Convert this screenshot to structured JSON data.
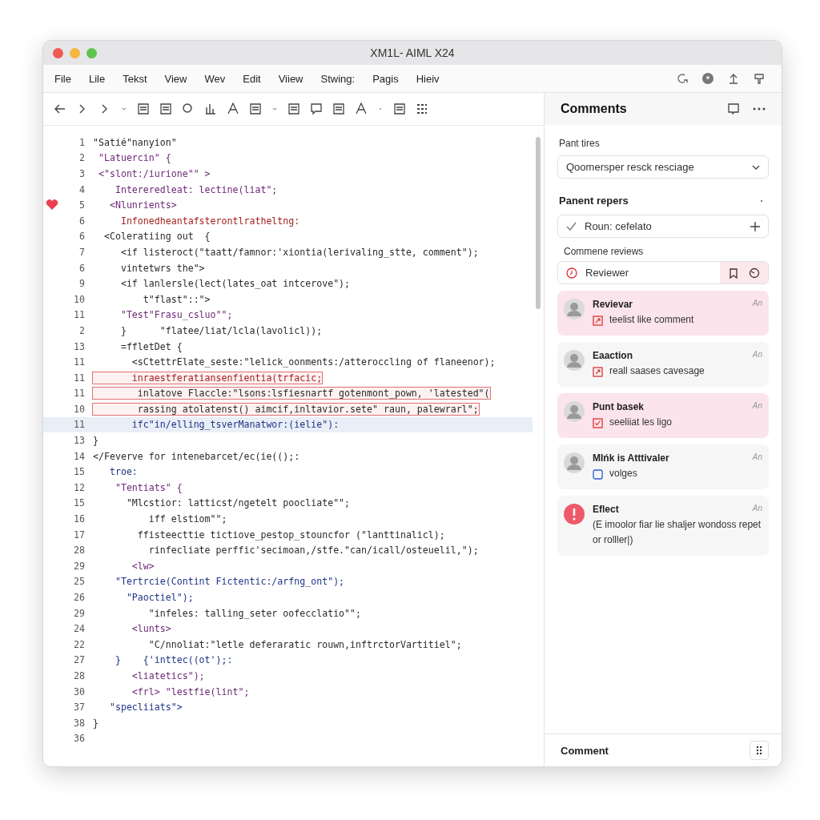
{
  "window": {
    "title": "XM1L- AIML X24"
  },
  "menu": [
    "File",
    "Lile",
    "Tekst",
    "View",
    "Wev",
    "Edit",
    "Viiew",
    "Stwing:",
    "Pagis",
    "Hieiv"
  ],
  "code": [
    {
      "n": "1",
      "text": "\"Satié\"nanyion\"",
      "kind": "plain",
      "flagged": false,
      "selected": false,
      "bookmarked": false
    },
    {
      "n": "2",
      "text": " \"Latuercin\" {",
      "kind": "tag",
      "flagged": false,
      "selected": false,
      "bookmarked": false
    },
    {
      "n": "3",
      "text": " <\"slont:/iurione\"\" >",
      "kind": "tag",
      "flagged": false,
      "selected": false,
      "bookmarked": false
    },
    {
      "n": "4",
      "text": "    Intereredleat: lectine(liat\";",
      "kind": "tag",
      "flagged": false,
      "selected": false,
      "bookmarked": false
    },
    {
      "n": "5",
      "text": "   <Nlunrients>",
      "kind": "tag",
      "flagged": false,
      "selected": false,
      "bookmarked": true
    },
    {
      "n": "6",
      "text": "     Infonedheantafsterontlratheltng:",
      "kind": "error",
      "flagged": false,
      "selected": false,
      "bookmarked": false
    },
    {
      "n": "6",
      "text": "  <Coleratiing out  {",
      "kind": "plain",
      "flagged": false,
      "selected": false,
      "bookmarked": false
    },
    {
      "n": "7",
      "text": "     <if listeroct(\"taatt/famnor:'xiontia(lerivaling_stte, comment\");",
      "kind": "plain",
      "flagged": false,
      "selected": false,
      "bookmarked": false
    },
    {
      "n": "6",
      "text": "     vintetwrs the\">",
      "kind": "plain",
      "flagged": false,
      "selected": false,
      "bookmarked": false
    },
    {
      "n": "9",
      "text": "     <if lanlersle(lect(lates_oat intcerove\");",
      "kind": "plain",
      "flagged": false,
      "selected": false,
      "bookmarked": false
    },
    {
      "n": "10",
      "text": "         t\"flast\"::\">",
      "kind": "plain",
      "flagged": false,
      "selected": false,
      "bookmarked": false
    },
    {
      "n": "11",
      "text": "     \"Test\"Frasu_csluo\"\";",
      "kind": "tag",
      "flagged": false,
      "selected": false,
      "bookmarked": false
    },
    {
      "n": "2",
      "text": "     }      \"flatee/liat/lcla(lavolicl));",
      "kind": "plain",
      "flagged": false,
      "selected": false,
      "bookmarked": false
    },
    {
      "n": "13",
      "text": "     =ffletDet {",
      "kind": "plain",
      "flagged": false,
      "selected": false,
      "bookmarked": false
    },
    {
      "n": "11",
      "text": "       <sCtettrElate_seste:\"lelick_oonments:/atteroccling of flaneenor);",
      "kind": "plain",
      "flagged": false,
      "selected": false,
      "bookmarked": false
    },
    {
      "n": "11",
      "text": "       inraestferatiansenfientia(trfacic;",
      "kind": "error",
      "flagged": true,
      "selected": false,
      "bookmarked": false
    },
    {
      "n": "11",
      "text": "        inlatove Flaccle:\"lsons:lsfiesnartf gotenmont_pown, 'latested\"(",
      "kind": "plain",
      "flagged": true,
      "selected": false,
      "bookmarked": false
    },
    {
      "n": "10",
      "text": "        rassing atolatenst() aimcif,inltavior.sete\" raun, palewrarl\";",
      "kind": "plain",
      "flagged": true,
      "selected": false,
      "bookmarked": false
    },
    {
      "n": "11",
      "text": "       ifc\"in/elling_tsverManatwor:(ielie\"):",
      "kind": "string",
      "flagged": false,
      "selected": true,
      "bookmarked": false
    },
    {
      "n": "13",
      "text": "}",
      "kind": "plain",
      "flagged": false,
      "selected": false,
      "bookmarked": false
    },
    {
      "n": "14",
      "text": "</Feverve for intenebarcet/ec(ie(();:",
      "kind": "plain",
      "flagged": false,
      "selected": false,
      "bookmarked": false
    },
    {
      "n": "15",
      "text": "   troe:",
      "kind": "string",
      "flagged": false,
      "selected": false,
      "bookmarked": false
    },
    {
      "n": "12",
      "text": "    \"Tentiats\" {",
      "kind": "tag",
      "flagged": false,
      "selected": false,
      "bookmarked": false
    },
    {
      "n": "15",
      "text": "      \"Mlcstior: latticst/ngetelt poocliate\"\";",
      "kind": "plain",
      "flagged": false,
      "selected": false,
      "bookmarked": false
    },
    {
      "n": "16",
      "text": "          iff elstiom\"\";",
      "kind": "plain",
      "flagged": false,
      "selected": false,
      "bookmarked": false
    },
    {
      "n": "17",
      "text": "        ffisteecttie tictiove_pestop_stouncfor (\"lanttinalicl);",
      "kind": "plain",
      "flagged": false,
      "selected": false,
      "bookmarked": false
    },
    {
      "n": "28",
      "text": "          rinfecliate perffic'secimoan,/stfe.\"can/icall/osteuelil,\");",
      "kind": "plain",
      "flagged": false,
      "selected": false,
      "bookmarked": false
    },
    {
      "n": "29",
      "text": "       <lw>",
      "kind": "tag",
      "flagged": false,
      "selected": false,
      "bookmarked": false
    },
    {
      "n": "25",
      "text": "    \"Tertrcie(Contint Fictentic:/arfng_ont\");",
      "kind": "string",
      "flagged": false,
      "selected": false,
      "bookmarked": false
    },
    {
      "n": "26",
      "text": "      \"Paoctiel\");",
      "kind": "string",
      "flagged": false,
      "selected": false,
      "bookmarked": false
    },
    {
      "n": "29",
      "text": "          \"infeles: talling_seter oofecclatio\"\";",
      "kind": "plain",
      "flagged": false,
      "selected": false,
      "bookmarked": false
    },
    {
      "n": "24",
      "text": "       <lunts>",
      "kind": "tag",
      "flagged": false,
      "selected": false,
      "bookmarked": false
    },
    {
      "n": "22",
      "text": "          \"C/nnoliat:\"letle deferaratic rouwn,inftrctorVartitiel\";",
      "kind": "plain",
      "flagged": false,
      "selected": false,
      "bookmarked": false
    },
    {
      "n": "27",
      "text": "    }    {'inttec((ot');:",
      "kind": "string",
      "flagged": false,
      "selected": false,
      "bookmarked": false
    },
    {
      "n": "28",
      "text": "       <liatetics\");",
      "kind": "tag",
      "flagged": false,
      "selected": false,
      "bookmarked": false
    },
    {
      "n": "30",
      "text": "       <frl> \"lestfie(lint\";",
      "kind": "tag",
      "flagged": false,
      "selected": false,
      "bookmarked": false
    },
    {
      "n": "37",
      "text": "   \"specliiats\">",
      "kind": "string",
      "flagged": false,
      "selected": false,
      "bookmarked": false
    },
    {
      "n": "38",
      "text": "}",
      "kind": "plain",
      "flagged": false,
      "selected": false,
      "bookmarked": false
    },
    {
      "n": "36"
    }
  ],
  "panel": {
    "title": "Comments",
    "filter_label": "Pant tires",
    "filter_value": "Qoomersper resck resciage",
    "section_title": "Panent repers",
    "rule_value": "Roun: cefelato",
    "reviews_label": "Commene reviews",
    "reviewer_value": "Reviewer",
    "comments": [
      {
        "author": "Revievar",
        "time": "An",
        "kind": "flag",
        "text": "teelist like comment",
        "selected": true
      },
      {
        "author": "Eaaction",
        "time": "An",
        "kind": "flag",
        "text": "reall saases cavesage",
        "selected": false
      },
      {
        "author": "Punt basek",
        "time": "An",
        "kind": "check",
        "text": "seeliiat les ligo",
        "selected": true
      },
      {
        "author": "MIńk is Atttivaler",
        "time": "An",
        "kind": "frame",
        "text": "volges",
        "selected": false
      },
      {
        "author": "Eflect",
        "time": "An",
        "kind": "alert",
        "text": "(E imoolor fiar lie shaljer wondoss repet or rolller|)",
        "selected": false
      }
    ],
    "footer": "Comment"
  }
}
